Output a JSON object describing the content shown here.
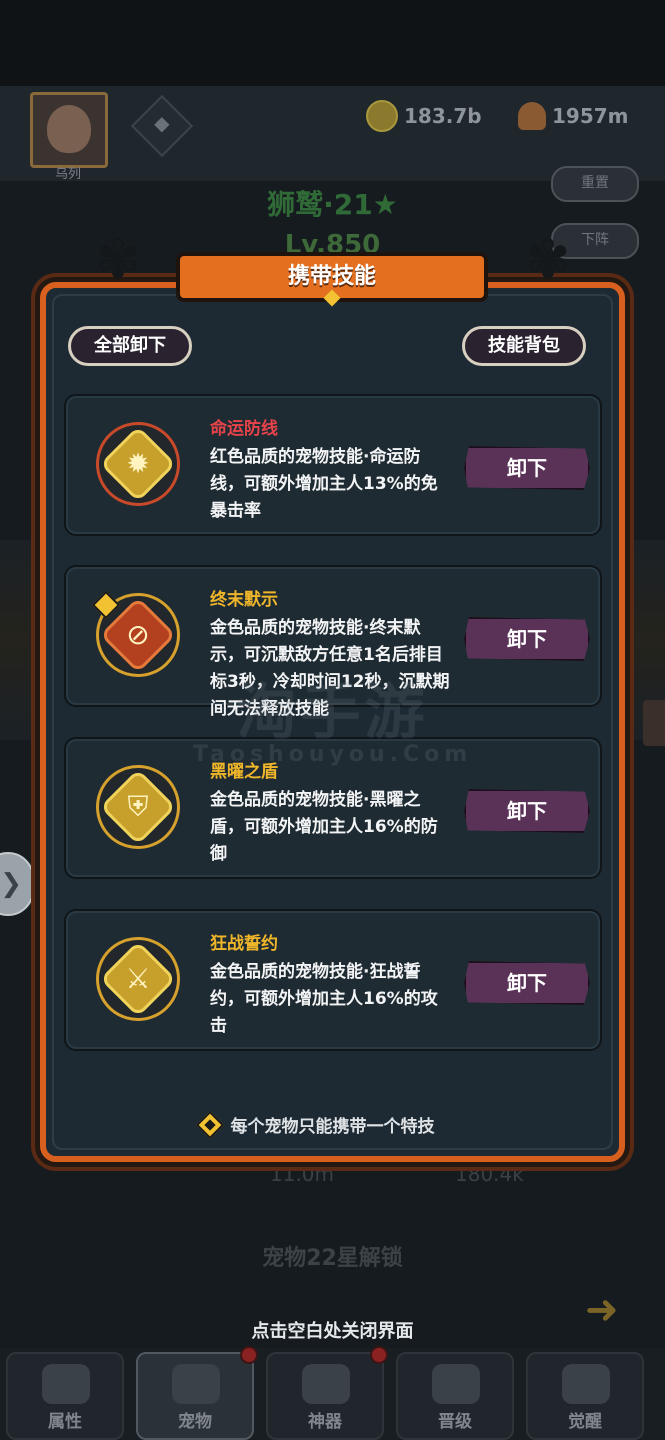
{
  "background": {
    "avatar_name": "乌列",
    "currency_gold": "183.7b",
    "currency_mushroom": "1957m",
    "btn_reset": "重置",
    "btn_down": "下阵",
    "pet_name": "狮鹫·21★",
    "pet_level": "Lv.850",
    "unlock_text": "宠物22星解锁",
    "faded_val_1": "11.0m",
    "faded_val_2": "180.4k",
    "close_hint": "点击空白处关闭界面",
    "tabs": [
      {
        "label": "属性"
      },
      {
        "label": "宠物"
      },
      {
        "label": "神器"
      },
      {
        "label": "晋级"
      },
      {
        "label": "觉醒"
      }
    ]
  },
  "modal": {
    "title": "携带技能",
    "unload_all": "全部卸下",
    "skill_bag": "技能背包",
    "skills": [
      {
        "name": "命运防线",
        "name_color": "#e8434a",
        "desc": "红色品质的宠物技能·命运防线，可额外增加主人13%的免暴击率",
        "button": "卸下",
        "icon": "burst-icon"
      },
      {
        "name": "终末默示",
        "name_color": "#f0b62a",
        "desc": "金色品质的宠物技能·终末默示，可沉默敌方任意1名后排目标3秒，冷却时间12秒，沉默期间无法释放技能",
        "button": "卸下",
        "icon": "silence-icon"
      },
      {
        "name": "黑曜之盾",
        "name_color": "#f0b62a",
        "desc": "金色品质的宠物技能·黑曜之盾，可额外增加主人16%的防御",
        "button": "卸下",
        "icon": "shield-icon"
      },
      {
        "name": "狂战誓约",
        "name_color": "#f0b62a",
        "desc": "金色品质的宠物技能·狂战誓约，可额外增加主人16%的攻击",
        "button": "卸下",
        "icon": "sword-icon"
      }
    ],
    "footer_note": "每个宠物只能携带一个特技"
  },
  "watermark": {
    "main": "淘手游",
    "sub": "Taoshouyou.Com"
  }
}
